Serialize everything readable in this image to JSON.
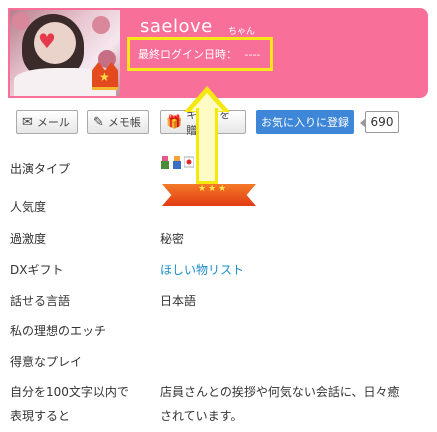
{
  "profile": {
    "name": "saelove",
    "name_suffix": "ちゃん",
    "last_login_label": "最終ログイン日時：",
    "last_login_value": "----"
  },
  "actions": {
    "mail": "メール",
    "memo": "メモ帳",
    "gift": "ギフトを贈る",
    "favorite": "お気に入りに登録",
    "favorite_count": "690"
  },
  "details": [
    {
      "label": "出演タイプ",
      "value": ""
    },
    {
      "label": "人気度",
      "value": ""
    },
    {
      "label": "過激度",
      "value": "秘密"
    },
    {
      "label": "DXギフト",
      "value": "ほしい物リスト"
    },
    {
      "label": "話せる言語",
      "value": "日本語"
    },
    {
      "label": "私の理想のエッチ",
      "value": ""
    },
    {
      "label": "得意なプレイ",
      "value": ""
    },
    {
      "label": "自分を100文字以内で",
      "value": "店員さんとの挨拶や何気ない会話に、日々癒"
    },
    {
      "label": "表現すると",
      "value": "されています。"
    }
  ],
  "colors": {
    "header": "#f8709a",
    "favorite_button": "#3d86d8",
    "link": "#1a8cc6",
    "highlight": "#f5e810"
  }
}
